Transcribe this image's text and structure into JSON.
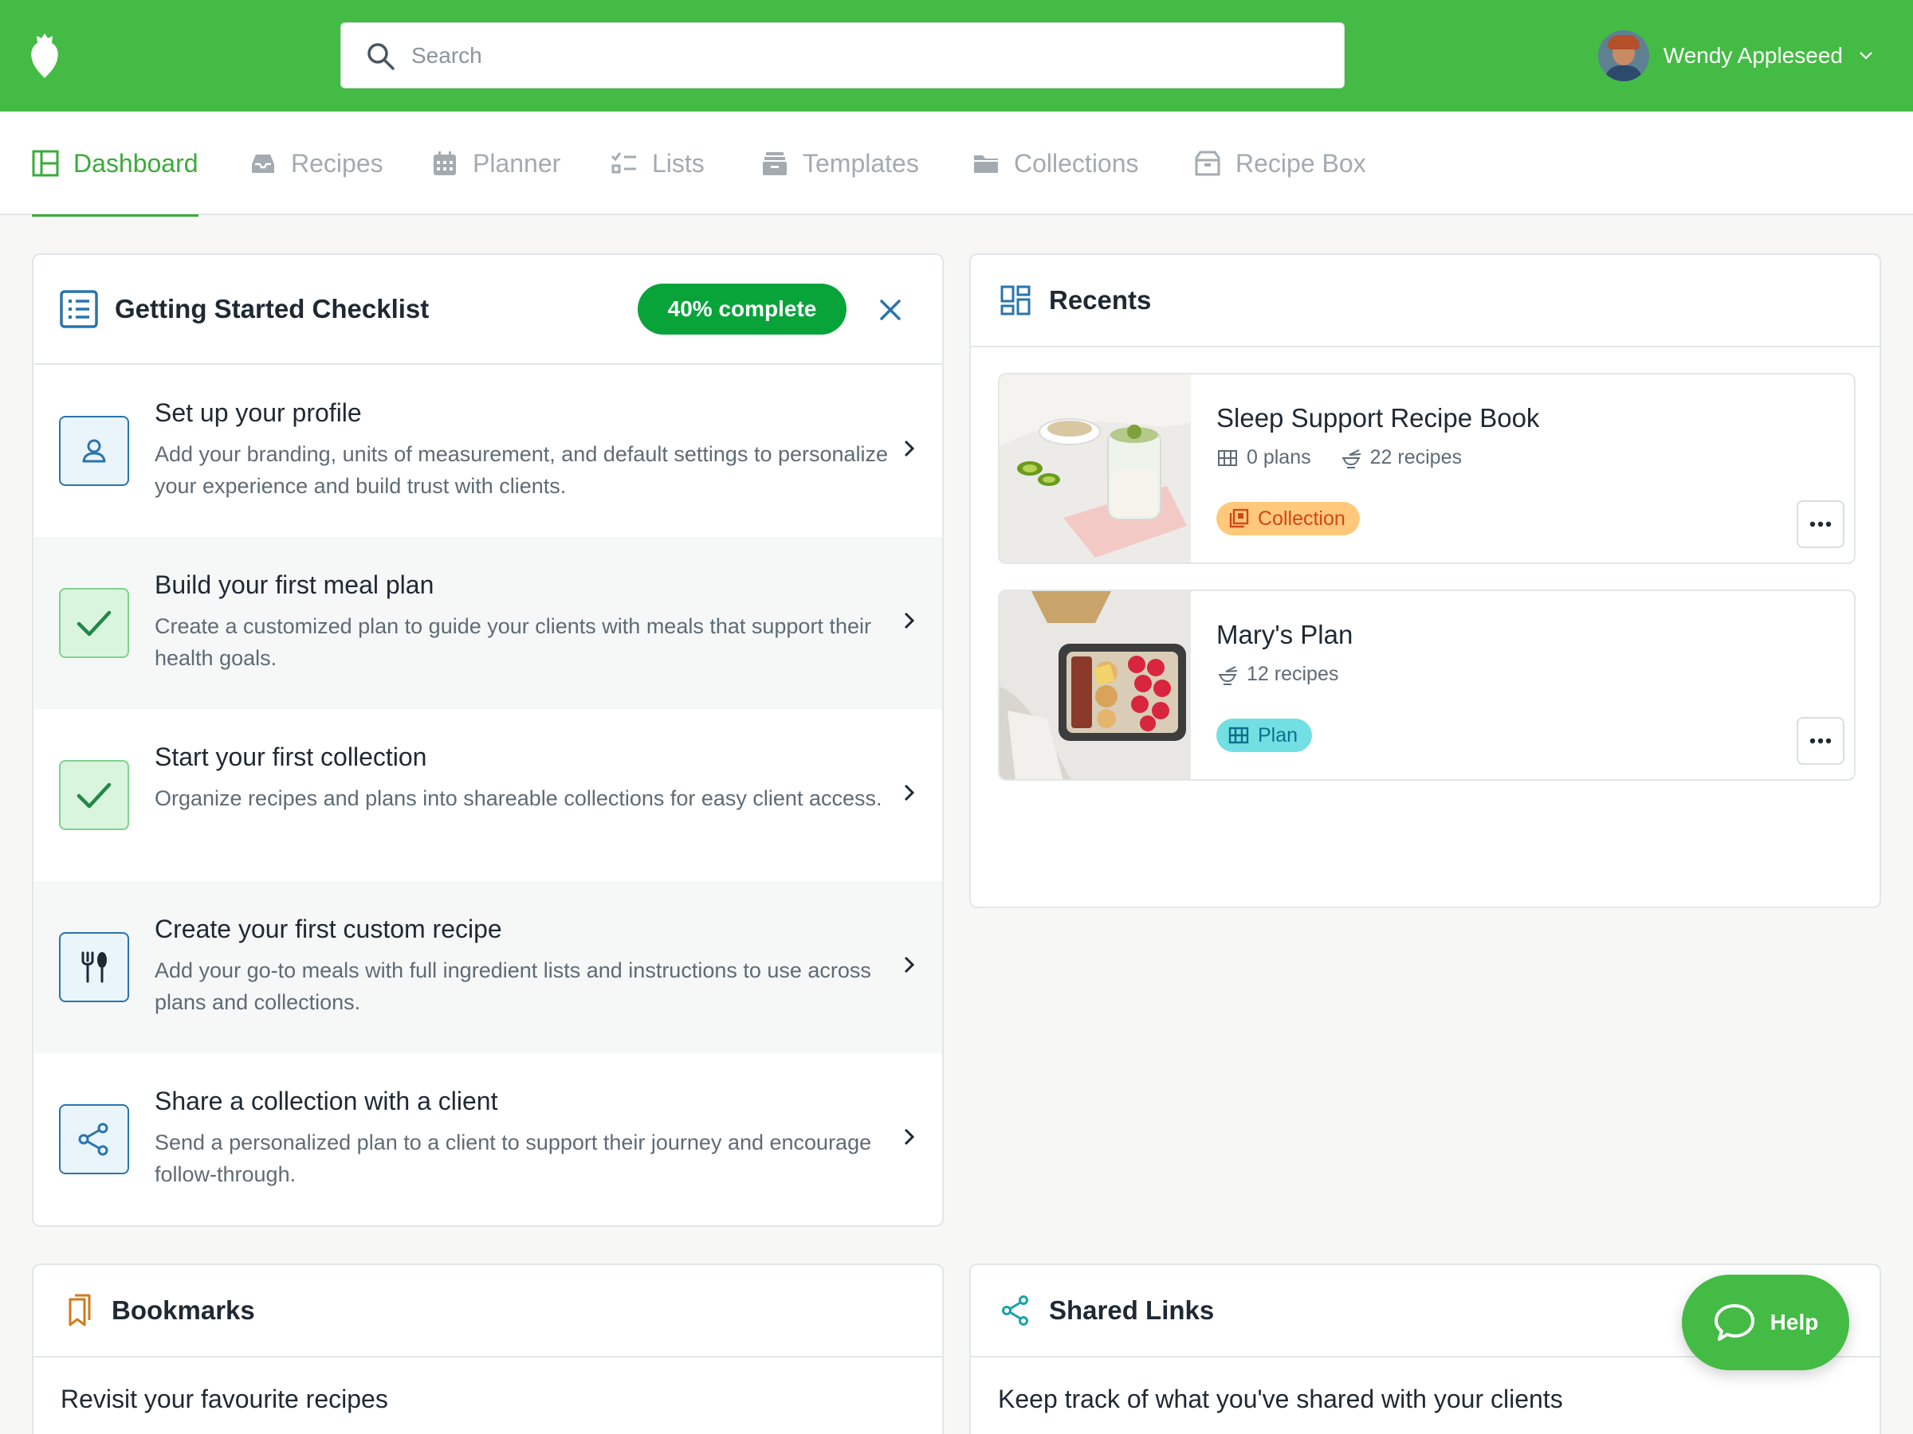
{
  "header": {
    "search_placeholder": "Search",
    "user_name": "Wendy Appleseed"
  },
  "nav": {
    "tabs": [
      {
        "label": "Dashboard",
        "icon": "dashboard-icon",
        "active": true
      },
      {
        "label": "Recipes",
        "icon": "inbox-icon",
        "active": false
      },
      {
        "label": "Planner",
        "icon": "calendar-icon",
        "active": false
      },
      {
        "label": "Lists",
        "icon": "checklist-icon",
        "active": false
      },
      {
        "label": "Templates",
        "icon": "archive-icon",
        "active": false
      },
      {
        "label": "Collections",
        "icon": "folder-icon",
        "active": false
      },
      {
        "label": "Recipe Box",
        "icon": "recipe-box-icon",
        "active": false
      }
    ]
  },
  "checklist": {
    "title": "Getting Started Checklist",
    "progress_label": "40% complete",
    "progress_fraction": 0.4,
    "items": [
      {
        "title": "Set up your profile",
        "description": "Add your branding, units of measurement, and default settings to personalize your experience and build trust with clients.",
        "icon": "profile-icon",
        "done": false
      },
      {
        "title": "Build your first meal plan",
        "description": "Create a customized plan to guide your clients with meals that support their health goals.",
        "icon": "check-icon",
        "done": true
      },
      {
        "title": "Start your first collection",
        "description": "Organize recipes and plans into shareable collections for easy client access.",
        "icon": "check-icon",
        "done": true
      },
      {
        "title": "Create your first custom recipe",
        "description": "Add your go-to meals with full ingredient lists and instructions to use across plans and collections.",
        "icon": "utensils-icon",
        "done": false
      },
      {
        "title": "Share a collection with a client",
        "description": "Send a personalized plan to a client to support their journey and encourage follow-through.",
        "icon": "share-icon",
        "done": false
      }
    ]
  },
  "recents": {
    "title": "Recents",
    "items": [
      {
        "title": "Sleep Support Recipe Book",
        "plans": "0 plans",
        "recipes": "22 recipes",
        "tag": "Collection"
      },
      {
        "title": "Mary's Plan",
        "recipes": "12 recipes",
        "tag": "Plan"
      }
    ]
  },
  "bookmarks": {
    "title": "Bookmarks",
    "subtitle": "Revisit your favourite recipes"
  },
  "shared_links": {
    "title": "Shared Links",
    "subtitle": "Keep track of what you've shared with your clients"
  },
  "help": {
    "label": "Help"
  },
  "colors": {
    "brand_green": "#44bb44",
    "progress_green": "#08a43a",
    "icon_blue": "#2a74ad",
    "collection_tag_bg": "#ffc87a",
    "plan_tag_bg": "#72e0e2"
  }
}
